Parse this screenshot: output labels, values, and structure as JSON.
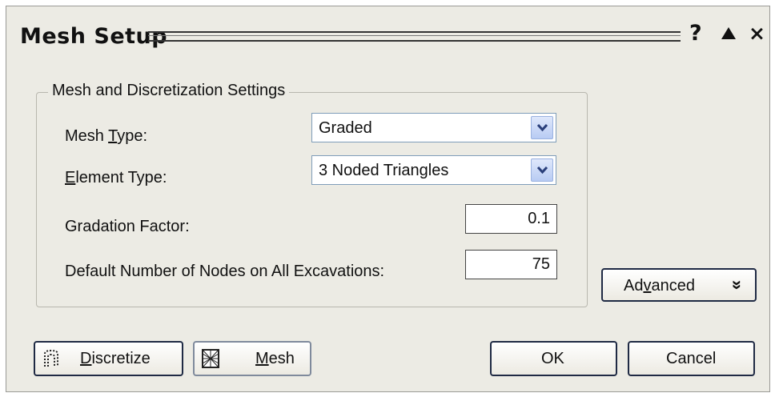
{
  "dialog": {
    "title": "Mesh Setup",
    "help_icon": "?",
    "close_icon": "×"
  },
  "group": {
    "legend": "Mesh and Discretization Settings"
  },
  "fields": {
    "mesh_type": {
      "label_pre": "Mesh ",
      "label_u": "T",
      "label_post": "ype:",
      "value": "Graded"
    },
    "element_type": {
      "label_u": "E",
      "label_post": "lement Type:",
      "value": "3 Noded Triangles"
    },
    "gradation_factor": {
      "label": "Gradation Factor:",
      "value": "0.1"
    },
    "default_nodes": {
      "label": "Default Number of Nodes on All Excavations:",
      "value": "75"
    }
  },
  "buttons": {
    "advanced": {
      "pre": "Ad",
      "u": "v",
      "post": "anced",
      "chevron": "»"
    },
    "discretize": {
      "u": "D",
      "post": "iscretize"
    },
    "mesh": {
      "u": "M",
      "post": "esh"
    },
    "ok": "OK",
    "cancel": "Cancel"
  },
  "icons": {
    "discretize": "discretize-icon",
    "mesh": "mesh-icon",
    "dropdown": "chevron-down-icon"
  }
}
